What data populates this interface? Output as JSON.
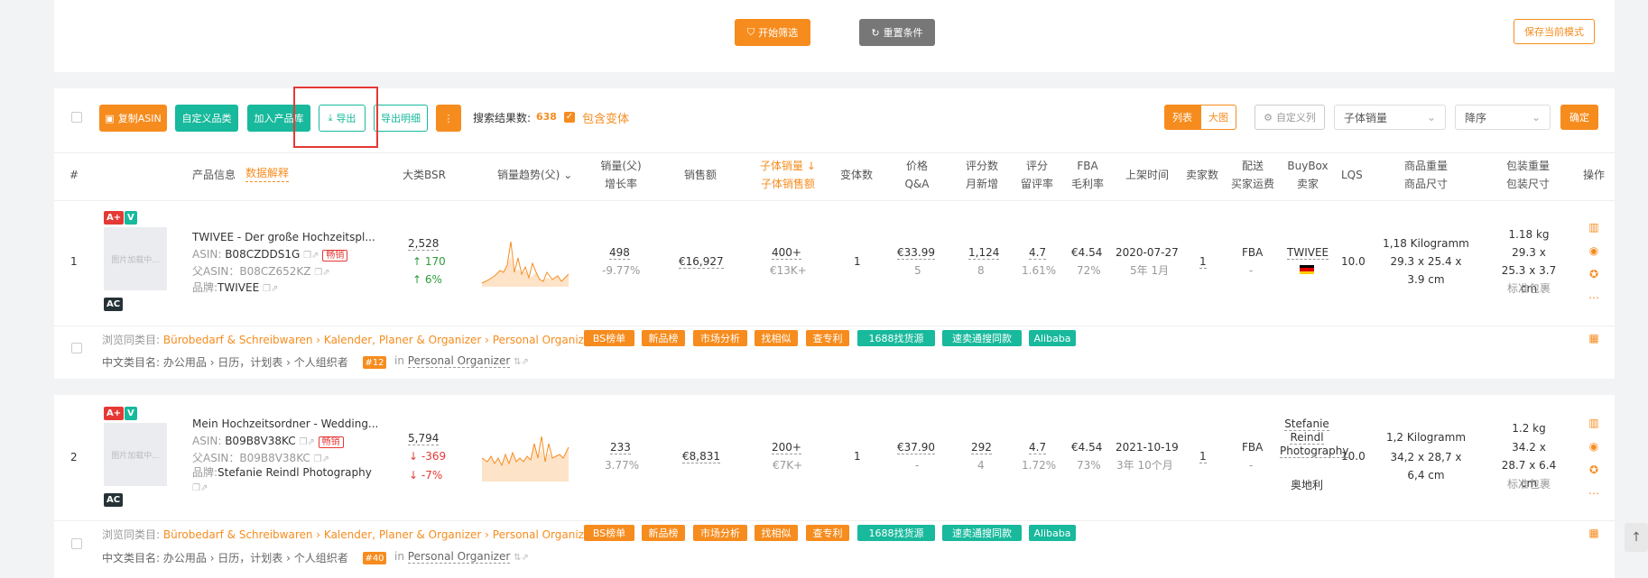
{
  "top": {
    "start_filter": "开始筛选",
    "reset": "重置条件",
    "save_mode": "保存当前模式"
  },
  "toolbar": {
    "copy_asin": "复制ASIN",
    "custom_category": "自定义品类",
    "add_product_lib": "加入产品库",
    "export": "导出",
    "export_detail": "导出明细",
    "more": "⋮",
    "result_label": "搜索结果数:",
    "result_count": "638",
    "include_variants": "包含变体",
    "view_list": "列表",
    "view_grid": "大图",
    "custom_columns": "自定义列",
    "sort_field": "子体销量",
    "sort_order": "降序",
    "confirm": "确定"
  },
  "headers": {
    "index": "#",
    "product_info": "产品信息",
    "data_explain": "数据解释",
    "bsr": "大类BSR",
    "sales_trend": "销量趋势(父)",
    "sales_parent": "销量(父)",
    "growth": "增长率",
    "revenue": "销售额",
    "child_sales": "子体销量",
    "child_revenue": "子体销售额",
    "variants": "变体数",
    "price": "价格",
    "qa": "Q&A",
    "reviews": "评分数",
    "monthly_new": "月新增",
    "rating": "评分",
    "retention": "留评率",
    "fba": "FBA",
    "margin": "毛利率",
    "launch": "上架时间",
    "sellers": "卖家数",
    "delivery": "配送",
    "seller_ship": "买家运费",
    "buybox": "BuyBox",
    "buybox_seller": "卖家",
    "lqs": "LQS",
    "weight": "商品重量",
    "size": "商品尺寸",
    "pkg_weight": "包装重量",
    "pkg_size": "包装尺寸",
    "ops": "操作"
  },
  "rows": [
    {
      "index": "1",
      "thumb": "图片加载中...",
      "title": "TWIVEE - Der große Hochzeitspl...",
      "asin_label": "ASIN: ",
      "asin": "B08CZDDS1G",
      "hot": "畅销",
      "parent_label": "父ASIN：",
      "parent": "B08CZ652KZ",
      "brand_label": "品牌:",
      "brand": "TWIVEE",
      "bsr": "2,528",
      "bsr_change": "↑ 170",
      "bsr_pct": "↑ 6%",
      "sales": "498",
      "growth": "-9.77%",
      "revenue": "€16,927",
      "child_sales": "400+",
      "child_revenue": "€13K+",
      "variants": "1",
      "price": "€33.99",
      "qa": "5",
      "reviews": "1,124",
      "monthly_new": "8",
      "rating": "4.7",
      "retention": "1.61%",
      "fba": "€4.54",
      "margin": "72%",
      "launch": "2020-07-27",
      "launch_age": "5年 1月",
      "sellers": "1",
      "delivery": "FBA",
      "ship_fee": "-",
      "buybox": "TWIVEE",
      "lqs": "10.0",
      "weight": "1,18 Kilogramm",
      "size": "29.3 x 25.4 x 3.9 cm",
      "pkg_weight": "1.18 kg",
      "pkg_size": "29.3 x 25.3 x 3.7 cm",
      "pkg_type": "标准包裹",
      "browse_label": "浏览同类目:",
      "browse_path": "Bürobedarf & Schreibwaren › Kalender, Planer & Organizer › Personal Organizer",
      "cn_label": "中文类目名:",
      "cn_path": "办公用品 › 日历，计划表 › 个人组织者",
      "rank": "#12",
      "rank_in": "in",
      "rank_cat": "Personal Organizer"
    },
    {
      "index": "2",
      "thumb": "图片加载中...",
      "title": "Mein Hochzeitsordner - Wedding...",
      "asin_label": "ASIN: ",
      "asin": "B09B8V38KC",
      "hot": "畅销",
      "parent_label": "父ASIN：",
      "parent": "B09B8V38KC",
      "brand_label": "品牌:",
      "brand": "Stefanie Reindl Photography",
      "bsr": "5,794",
      "bsr_change": "↓ -369",
      "bsr_pct": "↓ -7%",
      "sales": "233",
      "growth": "3.77%",
      "revenue": "€8,831",
      "child_sales": "200+",
      "child_revenue": "€7K+",
      "variants": "1",
      "price": "€37.90",
      "qa": "-",
      "reviews": "292",
      "monthly_new": "4",
      "rating": "4.7",
      "retention": "1.72%",
      "fba": "€4.54",
      "margin": "73%",
      "launch": "2021-10-19",
      "launch_age": "3年 10个月",
      "sellers": "1",
      "delivery": "FBA",
      "ship_fee": "-",
      "buybox": "Stefanie Reindl Photography",
      "buybox_country": "奥地利",
      "lqs": "10.0",
      "weight": "1,2 Kilogramm",
      "size": "34,2 x 28,7 x 6,4 cm",
      "pkg_weight": "1.2 kg",
      "pkg_size": "34.2 x 28.7 x 6.4 cm",
      "pkg_type": "标准包裹",
      "browse_label": "浏览同类目:",
      "browse_path": "Bürobedarf & Schreibwaren › Kalender, Planer & Organizer › Personal Organizer",
      "cn_label": "中文类目名:",
      "cn_path": "办公用品 › 日历，计划表 › 个人组织者",
      "rank": "#40",
      "rank_in": "in",
      "rank_cat": "Personal Organizer"
    }
  ],
  "tags": [
    "BS榜单",
    "新品榜",
    "市场分析",
    "找相似",
    "查专利",
    "1688找货源",
    "速卖通搜同款",
    "Alibaba"
  ],
  "badges": {
    "aplus": "A+",
    "v": "V",
    "ac": "AC"
  },
  "colors": {
    "accent": "#f68c1e",
    "teal": "#18b99c",
    "highlight": "#e53935"
  }
}
